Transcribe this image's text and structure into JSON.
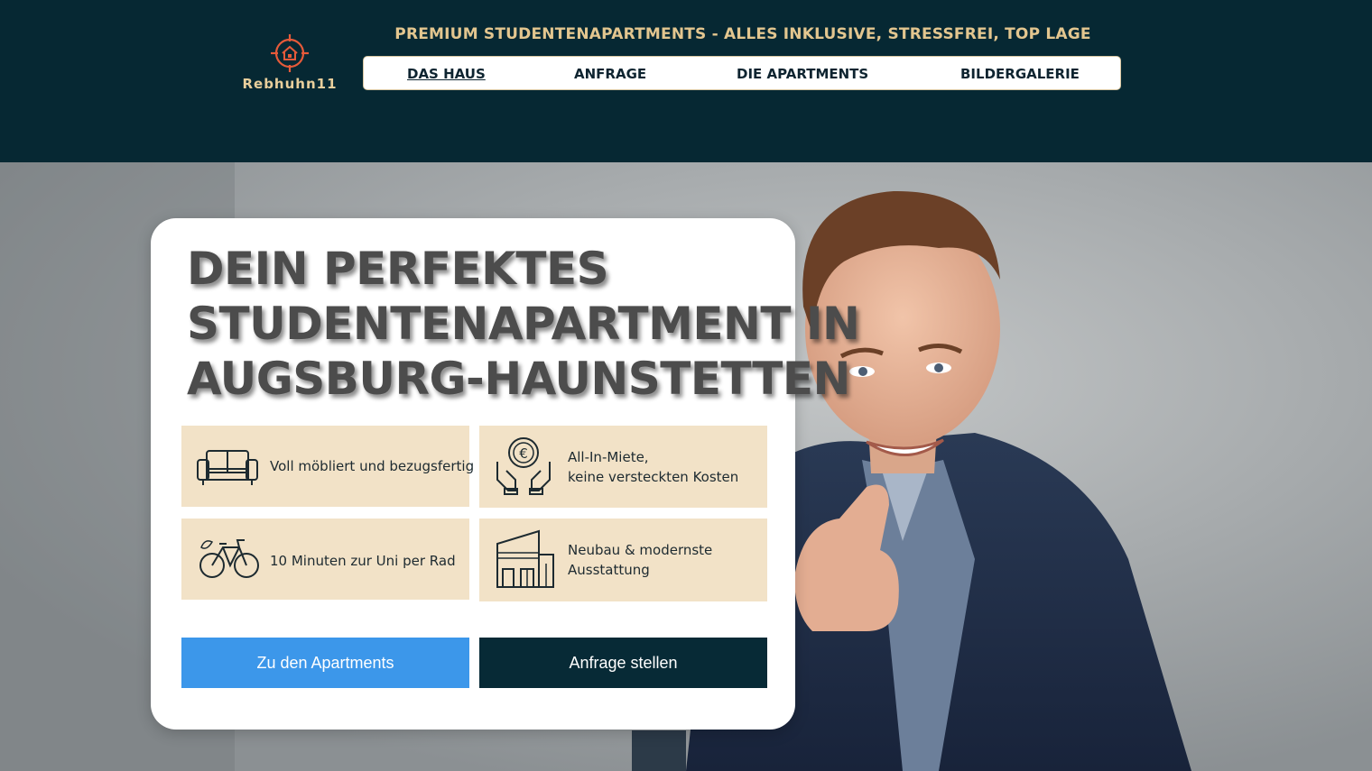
{
  "brand": {
    "name": "Rebhuhn11",
    "icon": "target-house-icon",
    "color": "#e55a3a"
  },
  "header": {
    "tagline": "PREMIUM STUDENTENAPARTMENTS - ALLES INKLUSIVE, STRESSFREI, TOP LAGE",
    "background": "#062833"
  },
  "nav": {
    "items": [
      {
        "label": "DAS HAUS",
        "active": true
      },
      {
        "label": "ANFRAGE"
      },
      {
        "label": "DIE APARTMENTS"
      },
      {
        "label": "BILDERGALERIE"
      }
    ]
  },
  "hero": {
    "headline": [
      "DEIN PERFEKTES",
      "STUDENTENAPARTMENT IN",
      "AUGSBURG-HAUNSTETTEN"
    ],
    "features": [
      {
        "icon": "sofa-icon",
        "lines": [
          "Voll möbliert und bezugsfertig"
        ]
      },
      {
        "icon": "euro-hands-icon",
        "lines": [
          "All-In-Miete,",
          "keine versteckten Kosten"
        ]
      },
      {
        "icon": "bicycle-icon",
        "lines": [
          "10 Minuten zur Uni per Rad"
        ]
      },
      {
        "icon": "building-icon",
        "lines": [
          "Neubau & modernste",
          "Ausstattung"
        ]
      }
    ],
    "buttons": {
      "apartments": "Zu den Apartments",
      "inquiry": "Anfrage stellen"
    },
    "colors": {
      "feature_bg": "#f2e2c7",
      "button_blue": "#3c97ea",
      "button_dark": "#072a36"
    }
  }
}
